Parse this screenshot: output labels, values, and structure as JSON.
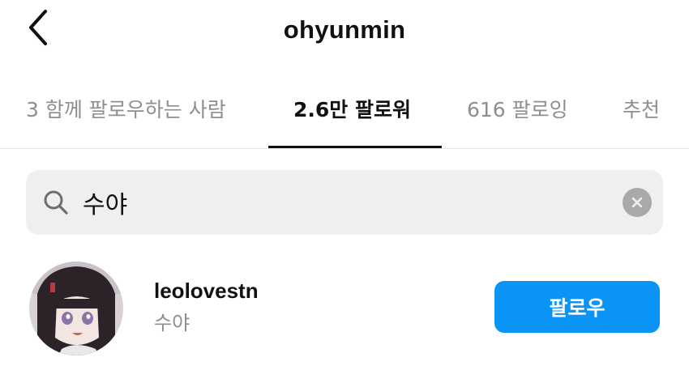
{
  "header": {
    "title": "ohyunmin",
    "back_icon": "chevron-left-icon"
  },
  "tabs": [
    {
      "label": "3 함께 팔로우하는 사람",
      "active": false
    },
    {
      "label": "2.6만 팔로워",
      "active": true
    },
    {
      "label": "616 팔로잉",
      "active": false
    },
    {
      "label": "추천",
      "active": false
    }
  ],
  "search": {
    "value": "수야",
    "search_icon": "search-icon",
    "clear_icon": "clear-icon"
  },
  "results": [
    {
      "username": "leolovestn",
      "full_name": "수야",
      "button_label": "팔로우"
    }
  ],
  "colors": {
    "accent": "#0a95f6",
    "secondary_text": "#8e8e8e",
    "search_background": "#efefef"
  }
}
